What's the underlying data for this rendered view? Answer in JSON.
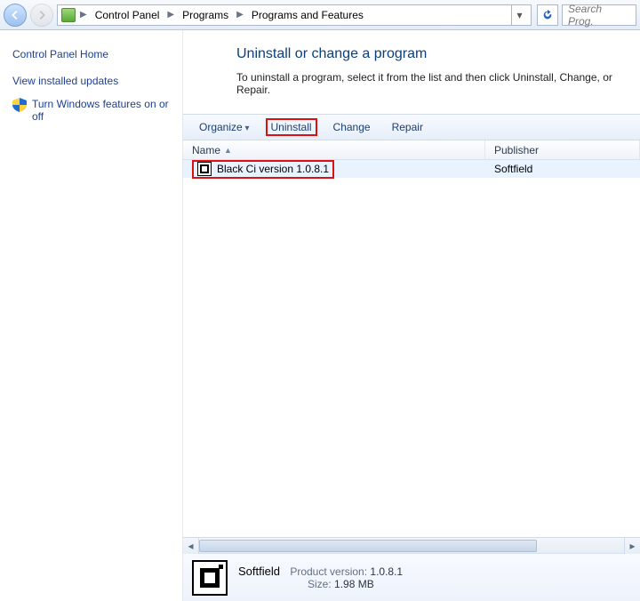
{
  "breadcrumb": [
    "Control Panel",
    "Programs",
    "Programs and Features"
  ],
  "search": {
    "placeholder": "Search Prog."
  },
  "sidebar": {
    "home": "Control Panel Home",
    "links": [
      {
        "label": "View installed updates",
        "icon": null
      },
      {
        "label": "Turn Windows features on or off",
        "icon": "shield"
      }
    ]
  },
  "page": {
    "title": "Uninstall or change a program",
    "desc": "To uninstall a program, select it from the list and then click Uninstall, Change, or Repair."
  },
  "toolbar": {
    "organize": "Organize",
    "uninstall": "Uninstall",
    "change": "Change",
    "repair": "Repair"
  },
  "columns": {
    "name": "Name",
    "publisher": "Publisher"
  },
  "rows": [
    {
      "name": "Black Ci version 1.0.8.1",
      "publisher": "Softfield"
    }
  ],
  "details": {
    "publisher": "Softfield",
    "product_version_label": "Product version:",
    "product_version": "1.0.8.1",
    "size_label": "Size:",
    "size": "1.98 MB"
  }
}
